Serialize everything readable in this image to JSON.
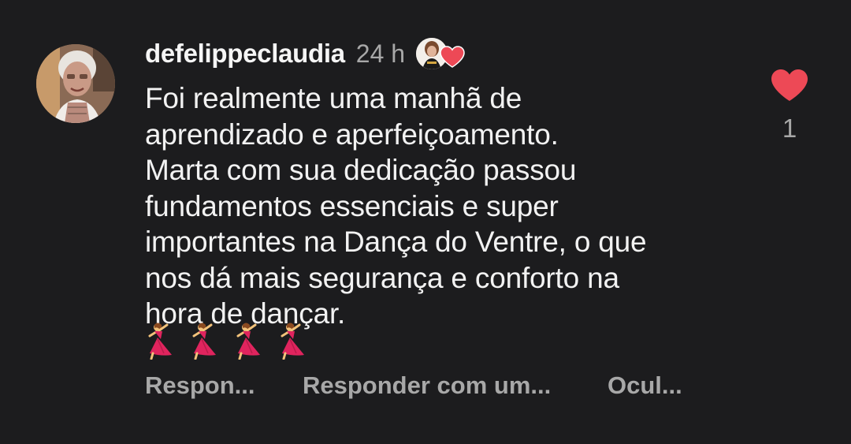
{
  "comment": {
    "username": "defelippeclaudia",
    "time": "24 h",
    "text": "Foi realmente uma manhã de\naprendizado e aperfeiçoamento.\nMarta com sua dedicação passou\nfundamentos essenciais e super\nimportantes na Dança do Ventre, o que\nnos dá mais segurança e conforto na\nhora de dançar.",
    "emojis": [
      "dancer-emoji",
      "dancer-emoji",
      "dancer-emoji",
      "dancer-emoji"
    ],
    "author_liked_icon": "heart-icon",
    "like_count": "1",
    "like_icon": "heart-icon",
    "actions": {
      "reply": "Respon...",
      "reply_with": "Responder com um...",
      "hide": "Ocul..."
    },
    "colors": {
      "background": "#1c1c1e",
      "text": "#f2f2f2",
      "muted": "#a8a8a8",
      "heart": "#ed4956"
    }
  }
}
